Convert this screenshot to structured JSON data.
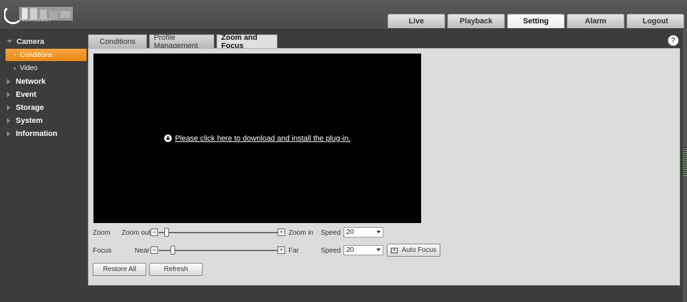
{
  "header": {
    "logo_sub": "TECHNOLOGY",
    "nav": [
      {
        "label": "Live",
        "active": false
      },
      {
        "label": "Playback",
        "active": false
      },
      {
        "label": "Setting",
        "active": true
      },
      {
        "label": "Alarm",
        "active": false
      },
      {
        "label": "Logout",
        "active": false
      }
    ]
  },
  "sidebar": {
    "camera": "Camera",
    "conditions": "Conditions",
    "video": "Video",
    "network": "Network",
    "event": "Event",
    "storage": "Storage",
    "system": "System",
    "information": "Information"
  },
  "tabs": {
    "conditions": "Conditions",
    "profile": "Profile Management",
    "zoom_focus": "Zoom and Focus"
  },
  "help": "?",
  "video": {
    "plugin_text": "Please click here to download and install the plug-in."
  },
  "zoom": {
    "label": "Zoom",
    "out": "Zoom out",
    "in": "Zoom in",
    "speed_label": "Speed",
    "speed": "20",
    "level": 0.05
  },
  "focus": {
    "label": "Focus",
    "near": "Near",
    "far": "Far",
    "speed_label": "Speed",
    "speed": "20",
    "level": 0.1,
    "auto_focus": "Auto Focus"
  },
  "buttons": {
    "restore": "Restore All",
    "refresh": "Refresh"
  },
  "colors": {
    "accent": "#e98714",
    "video_bg": "#000000"
  }
}
